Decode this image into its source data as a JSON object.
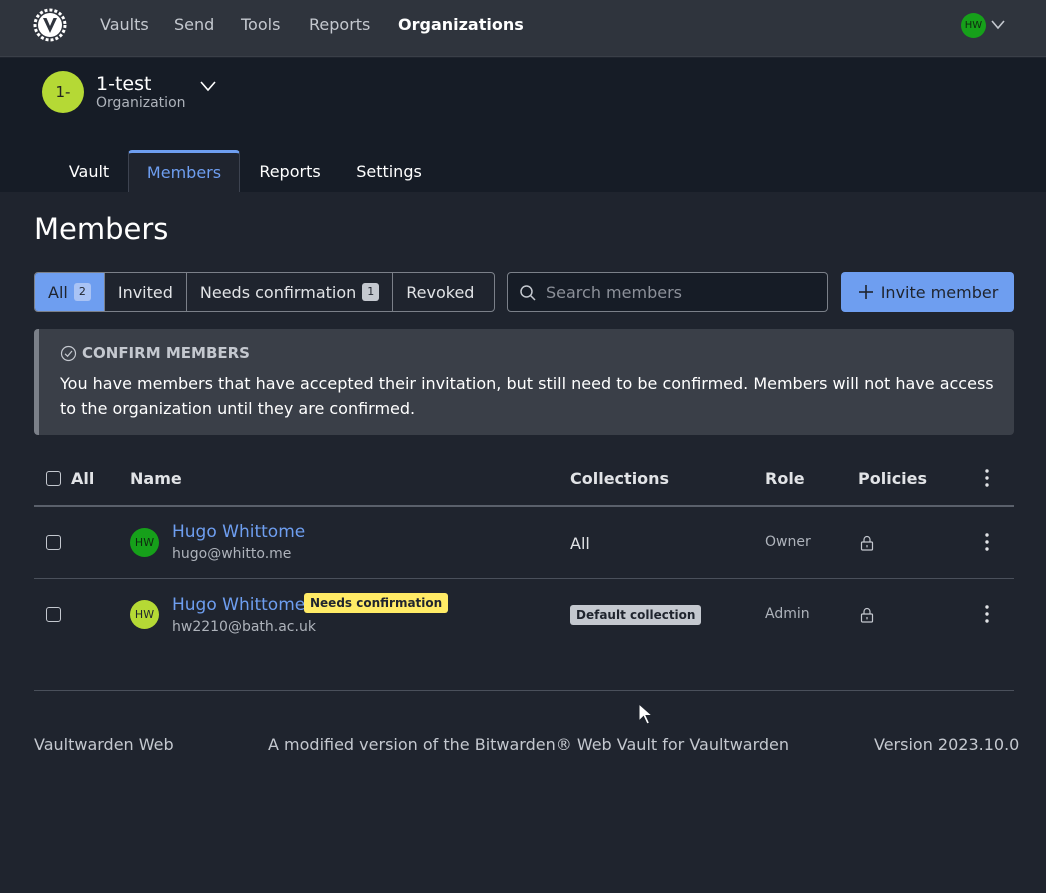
{
  "topnav": {
    "items": [
      {
        "label": "Vaults"
      },
      {
        "label": "Send"
      },
      {
        "label": "Tools"
      },
      {
        "label": "Reports"
      },
      {
        "label": "Organizations"
      }
    ],
    "user_initials": "HW"
  },
  "org": {
    "avatar_text": "1-",
    "name": "1-test",
    "type": "Organization",
    "tabs": [
      {
        "label": "Vault"
      },
      {
        "label": "Members"
      },
      {
        "label": "Reports"
      },
      {
        "label": "Settings"
      }
    ]
  },
  "page": {
    "title": "Members"
  },
  "filters": [
    {
      "label": "All",
      "count": "2"
    },
    {
      "label": "Invited"
    },
    {
      "label": "Needs confirmation",
      "count": "1"
    },
    {
      "label": "Revoked"
    }
  ],
  "search": {
    "placeholder": "Search members"
  },
  "invite_label": "Invite member",
  "callout": {
    "title": "CONFIRM MEMBERS",
    "body": "You have members that have accepted their invitation, but still need to be confirmed. Members will not have access to the organization until they are confirmed."
  },
  "table": {
    "headers": {
      "all": "All",
      "name": "Name",
      "collections": "Collections",
      "role": "Role",
      "policies": "Policies"
    },
    "rows": [
      {
        "initials": "HW",
        "name": "Hugo Whittome",
        "email": "hugo@whitto.me",
        "collections": "All",
        "role": "Owner"
      },
      {
        "initials": "HW",
        "name": "Hugo Whittome",
        "status_badge": "Needs confirmation",
        "email": "hw2210@bath.ac.uk",
        "collections": "Default collection",
        "role": "Admin"
      }
    ]
  },
  "footer": {
    "left": "Vaultwarden Web",
    "center": "A modified version of the Bitwarden® Web Vault for Vaultwarden",
    "right": "Version 2023.10.0"
  },
  "colors": {
    "accent": "#6e9ef0",
    "warning": "#ffeb66",
    "background": "#1f242e"
  }
}
